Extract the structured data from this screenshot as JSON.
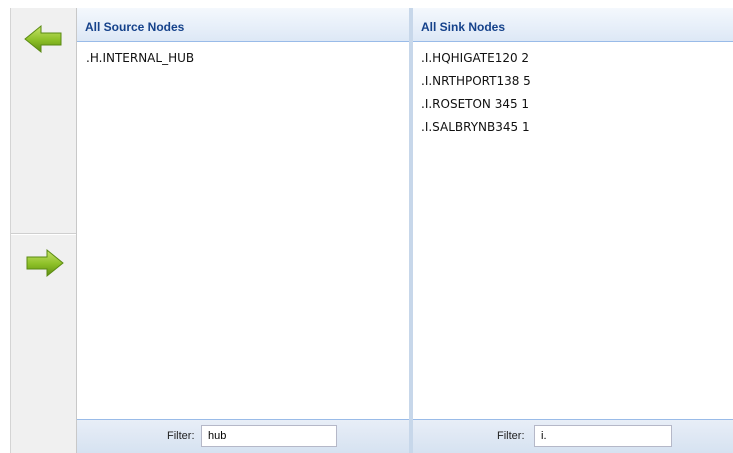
{
  "toolbar": {
    "move_left_icon": "arrow-left-icon",
    "move_right_icon": "arrow-right-icon",
    "arrow_color": "#8cbf26"
  },
  "source": {
    "title": "All Source Nodes",
    "items": [
      ".H.INTERNAL_HUB"
    ],
    "filter_label": "Filter:",
    "filter_value": "hub"
  },
  "sink": {
    "title": "All Sink Nodes",
    "items": [
      ".I.HQHIGATE120 2",
      ".I.NRTHPORT138 5",
      ".I.ROSETON 345 1",
      ".I.SALBRYNB345 1"
    ],
    "filter_label": "Filter:",
    "filter_value": "i."
  },
  "colors": {
    "header_text": "#15428b",
    "header_border": "#99bbe8"
  }
}
